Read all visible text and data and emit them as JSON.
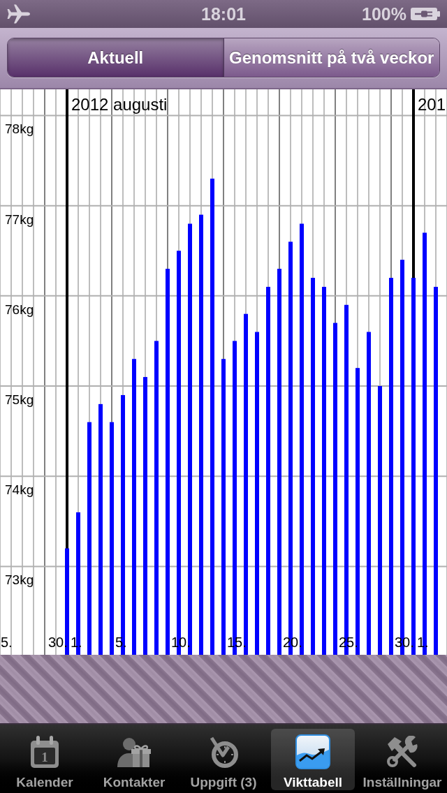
{
  "status_bar": {
    "time": "18:01",
    "battery": "100%"
  },
  "segmented_control": {
    "segments": [
      {
        "label": "Aktuell",
        "selected": true
      },
      {
        "label": "Genomsnitt på två veckor",
        "selected": false
      }
    ]
  },
  "chart": {
    "chart_data": {
      "type": "bar",
      "categories": [
        "5.",
        null,
        null,
        null,
        null,
        "30.",
        null,
        "1.",
        null,
        null,
        null,
        "5.",
        null,
        null,
        null,
        null,
        "10.",
        null,
        null,
        null,
        null,
        "15.",
        null,
        null,
        null,
        null,
        "20.",
        null,
        null,
        null,
        null,
        "25.",
        null,
        null,
        null,
        null,
        "30.",
        null,
        "1.",
        null
      ],
      "series": [
        {
          "color": "#0000ff",
          "values": [
            null,
            null,
            null,
            null,
            null,
            null,
            73.2,
            73.6,
            74.6,
            74.8,
            74.6,
            74.9,
            75.3,
            75.1,
            75.5,
            76.3,
            76.5,
            76.8,
            76.9,
            77.3,
            75.3,
            75.5,
            75.8,
            75.6,
            76.1,
            76.3,
            76.6,
            76.8,
            76.2,
            76.1,
            75.7,
            75.9,
            75.2,
            75.6,
            75.0,
            76.2,
            76.4,
            76.2,
            76.7,
            76.1
          ]
        }
      ],
      "ylim": [
        72.02,
        78.29
      ],
      "yticks": [
        {
          "value": 73,
          "label": "73kg"
        },
        {
          "value": 74,
          "label": "74kg"
        },
        {
          "value": 75,
          "label": "75kg"
        },
        {
          "value": 76,
          "label": "76kg"
        },
        {
          "value": 77,
          "label": "77kg"
        },
        {
          "value": 78,
          "label": "78kg"
        }
      ],
      "grid": true,
      "annotations": [
        "2012 augusti",
        "201"
      ]
    }
  },
  "tab_bar": {
    "tabs": [
      {
        "label": "Kalender",
        "selected": false,
        "icon_text": "1"
      },
      {
        "label": "Kontakter",
        "selected": false
      },
      {
        "label": "Uppgift (3)",
        "selected": false
      },
      {
        "label": "Vikttabell",
        "selected": true
      },
      {
        "label": "Inställningar",
        "selected": false
      }
    ]
  }
}
